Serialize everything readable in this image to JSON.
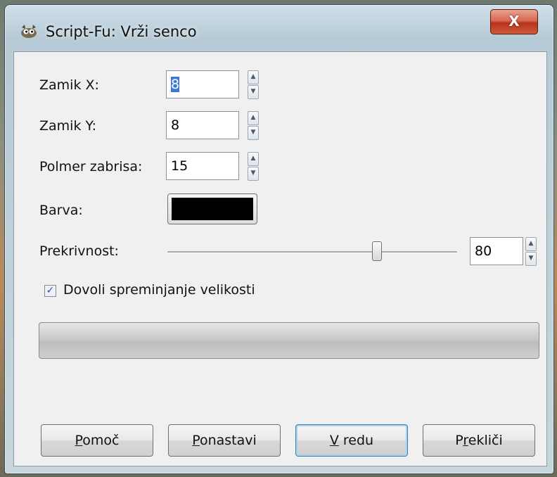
{
  "window": {
    "title": "Script-Fu: Vrži senco",
    "close_glyph": "X"
  },
  "fields": {
    "offset_x": {
      "label": "Zamik X:",
      "value": "8"
    },
    "offset_y": {
      "label": "Zamik Y:",
      "value": "8"
    },
    "blur_radius": {
      "label": "Polmer zabrisa:",
      "value": "15"
    },
    "color": {
      "label": "Barva:",
      "value": "#000000"
    },
    "opacity": {
      "label": "Prekrivnost:",
      "value": "80",
      "slider_fraction": 0.8
    }
  },
  "checkbox": {
    "label": "Dovoli spreminjanje velikosti",
    "checked": true
  },
  "progress": {
    "fraction": 0
  },
  "buttons": {
    "help": {
      "mnemonic": "P",
      "rest": "omoč"
    },
    "reset": {
      "mnemonic": "P",
      "rest": "onastavi"
    },
    "ok": {
      "mnemonic": "V",
      "rest": " redu"
    },
    "cancel": {
      "pre": "P",
      "mnemonic": "r",
      "rest": "ekliči"
    }
  },
  "icons": {
    "app": "gimp-wilber-icon",
    "spin_up": "arrow-up-icon",
    "spin_down": "arrow-down-icon",
    "check": "checkmark-icon"
  },
  "colors": {
    "selection": "#3a78d6",
    "swatch": "#000000",
    "close_button": "#c9452a"
  }
}
